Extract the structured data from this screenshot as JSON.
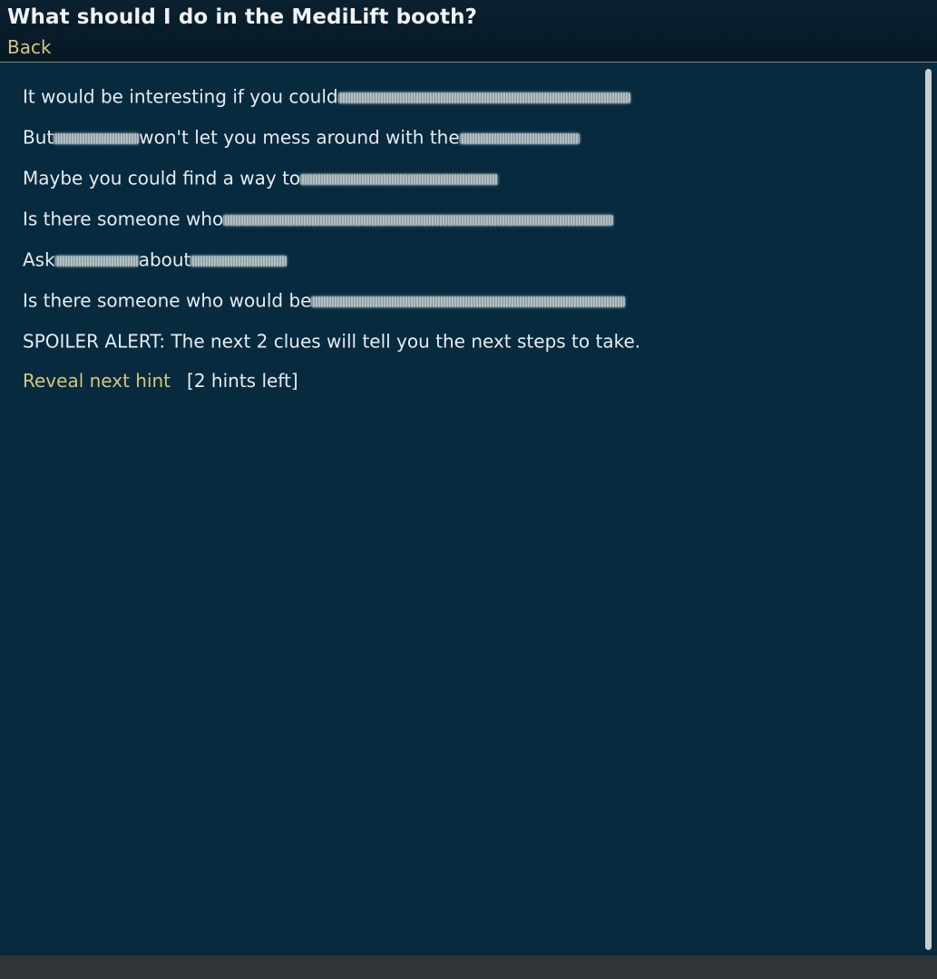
{
  "header": {
    "title": "What should I do in the MediLift booth?",
    "back_label": "Back"
  },
  "hints": [
    {
      "segments": [
        {
          "text": "It would be interesting if you could"
        },
        {
          "redacted": true,
          "w": 322
        }
      ]
    },
    {
      "segments": [
        {
          "text": "But"
        },
        {
          "redacted": true,
          "w": 94
        },
        {
          "text": "won't let you mess around with the"
        },
        {
          "redacted": true,
          "w": 132
        }
      ]
    },
    {
      "segments": [
        {
          "text": "Maybe you could find a way to"
        },
        {
          "redacted": true,
          "w": 218
        }
      ]
    },
    {
      "segments": [
        {
          "text": "Is there someone who"
        },
        {
          "redacted": true,
          "w": 430
        }
      ]
    },
    {
      "segments": [
        {
          "text": "Ask"
        },
        {
          "redacted": true,
          "w": 92
        },
        {
          "text": "about"
        },
        {
          "redacted": true,
          "w": 106
        }
      ]
    },
    {
      "segments": [
        {
          "text": "Is there someone who would be"
        },
        {
          "redacted": true,
          "w": 346
        }
      ]
    },
    {
      "segments": [
        {
          "text": "SPOILER ALERT: The next 2 clues will tell you the next steps to take."
        }
      ]
    }
  ],
  "reveal": {
    "link_label": "Reveal next hint",
    "hints_left": "[2 hints left]"
  }
}
